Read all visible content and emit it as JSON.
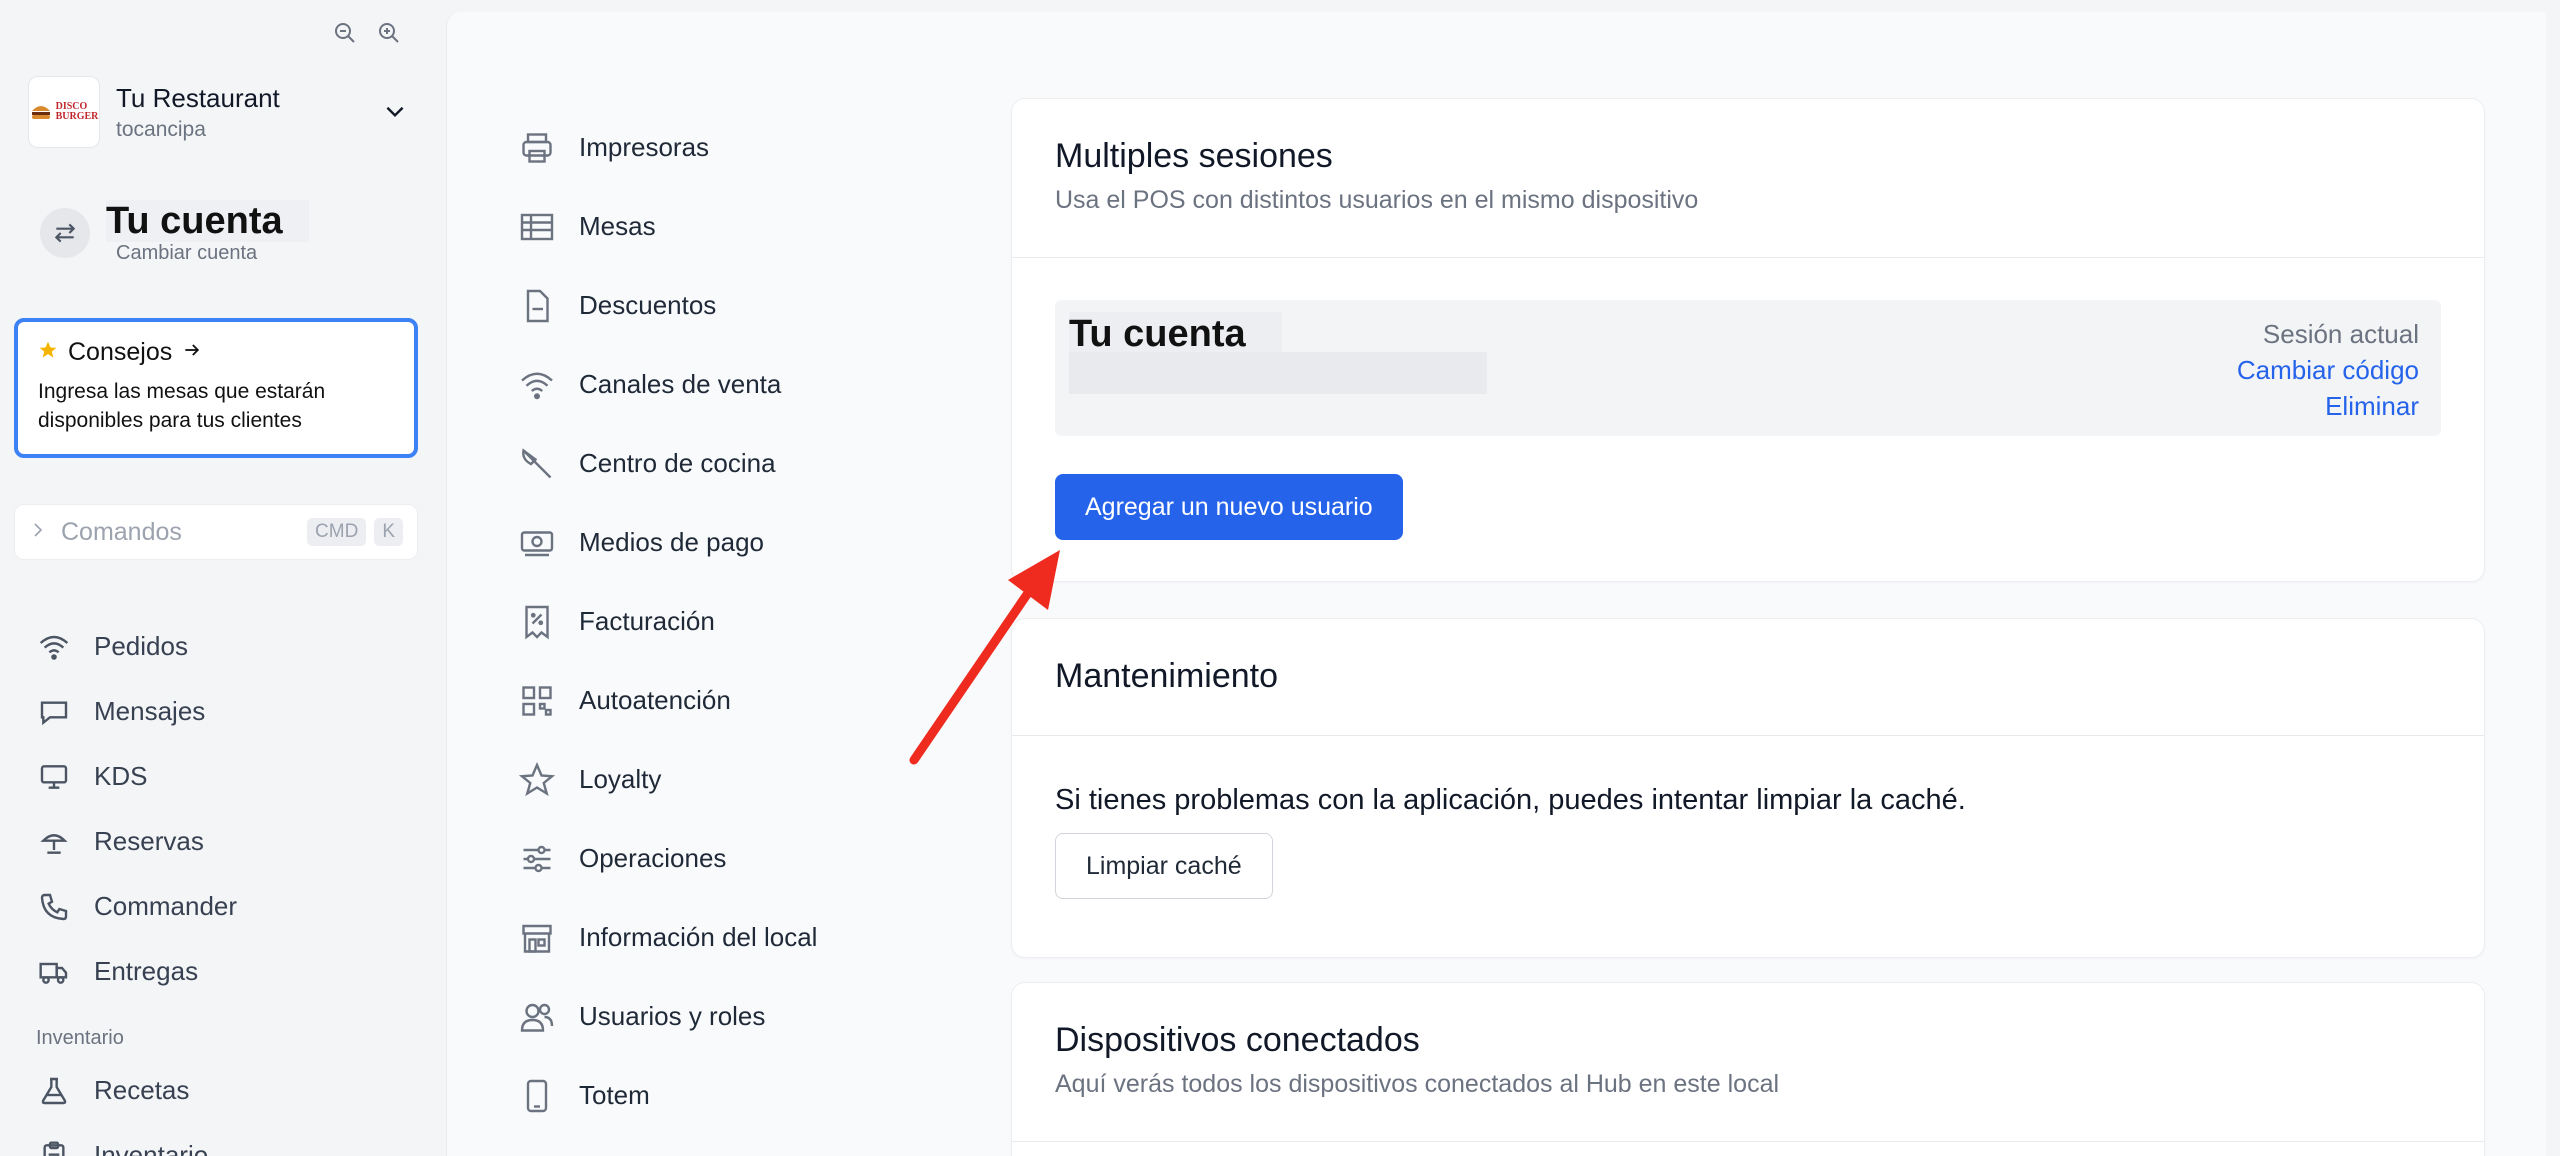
{
  "restaurant": {
    "logo_line1": "DISCO",
    "logo_line2": "BURGER",
    "name": "Tu Restaurant",
    "location": "tocancipa"
  },
  "account": {
    "title": "Tu cuenta",
    "switch_label": "Cambiar cuenta"
  },
  "tips": {
    "title": "Consejos",
    "body": "Ingresa las mesas que estarán disponibles para tus clientes"
  },
  "commands": {
    "placeholder": "Comandos",
    "key1": "CMD",
    "key2": "K"
  },
  "nav": {
    "items": [
      {
        "label": "Pedidos",
        "icon": "wifi-icon"
      },
      {
        "label": "Mensajes",
        "icon": "chat-icon"
      },
      {
        "label": "KDS",
        "icon": "monitor-icon"
      },
      {
        "label": "Reservas",
        "icon": "bell-icon"
      },
      {
        "label": "Commander",
        "icon": "phone-icon"
      },
      {
        "label": "Entregas",
        "icon": "truck-icon"
      }
    ],
    "section_inventory": "Inventario",
    "inventory_items": [
      {
        "label": "Recetas",
        "icon": "flask-icon"
      },
      {
        "label": "Inventario",
        "icon": "clipboard-icon"
      }
    ]
  },
  "settings_menu": {
    "items": [
      {
        "label": "Impresoras",
        "icon": "printer-icon"
      },
      {
        "label": "Mesas",
        "icon": "table-icon"
      },
      {
        "label": "Descuentos",
        "icon": "document-icon"
      },
      {
        "label": "Canales de venta",
        "icon": "wifi-icon"
      },
      {
        "label": "Centro de cocina",
        "icon": "knife-icon"
      },
      {
        "label": "Medios de pago",
        "icon": "cash-icon"
      },
      {
        "label": "Facturación",
        "icon": "receipt-icon"
      },
      {
        "label": "Autoatención",
        "icon": "qr-icon"
      },
      {
        "label": "Loyalty",
        "icon": "star-icon"
      },
      {
        "label": "Operaciones",
        "icon": "sliders-icon"
      },
      {
        "label": "Información del local",
        "icon": "store-icon"
      },
      {
        "label": "Usuarios y roles",
        "icon": "users-icon"
      },
      {
        "label": "Totem",
        "icon": "tablet-icon"
      }
    ]
  },
  "sessions": {
    "title": "Multiples sesiones",
    "description": "Usa el POS con distintos usuarios en el mismo dispositivo",
    "user_name": "Tu cuenta",
    "current_label": "Sesión actual",
    "change_code": "Cambiar código",
    "delete": "Eliminar",
    "add_user": "Agregar un nuevo usuario"
  },
  "maintenance": {
    "title": "Mantenimiento",
    "text": "Si tienes problemas con la aplicación, puedes intentar limpiar la caché.",
    "clear_cache": "Limpiar caché"
  },
  "devices": {
    "title": "Dispositivos conectados",
    "description": "Aquí verás todos los dispositivos conectados al Hub en este local"
  },
  "colors": {
    "accent": "#2563eb",
    "tips_border": "#3b82f6",
    "arrow": "#ef2b1f"
  }
}
